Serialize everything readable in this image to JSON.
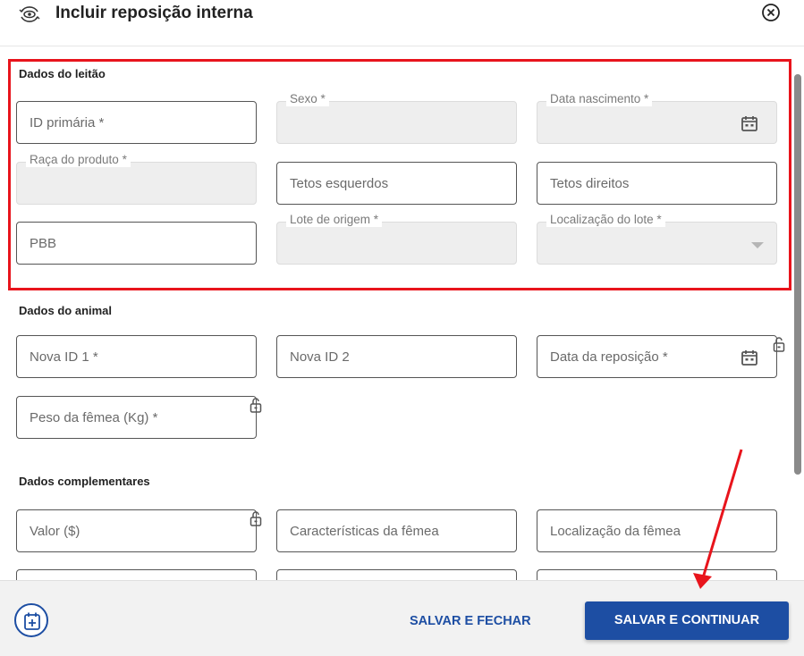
{
  "header": {
    "title": "Incluir reposição interna",
    "icon": "eye-refresh-icon",
    "close_icon": "close-circle-icon"
  },
  "sections": {
    "leitao": {
      "title": "Dados do leitão",
      "fields": {
        "id_primaria": "ID primária *",
        "sexo": "Sexo *",
        "data_nascimento": "Data nascimento *",
        "raca_produto": "Raça do produto *",
        "tetos_esquerdos": "Tetos esquerdos",
        "tetos_direitos": "Tetos direitos",
        "pbb": "PBB",
        "lote_origem": "Lote de origem *",
        "localizacao_lote": "Localização do lote *"
      }
    },
    "animal": {
      "title": "Dados do animal",
      "fields": {
        "nova_id_1": "Nova ID 1 *",
        "nova_id_2": "Nova ID 2",
        "data_reposicao": "Data da reposição *",
        "peso_femea": "Peso da fêmea (Kg) *"
      }
    },
    "complementares": {
      "title": "Dados complementares",
      "fields": {
        "valor": "Valor ($)",
        "caracteristicas_femea": "Características da fêmea",
        "localizacao_femea": "Localização da fêmea"
      }
    }
  },
  "footer": {
    "fab_icon": "calendar-plus-icon",
    "save_close_label": "SALVAR E FECHAR",
    "save_continue_label": "SALVAR E CONTINUAR"
  },
  "colors": {
    "primary": "#1d4ea3",
    "highlight": "#e8141c",
    "disabled_bg": "#eeeeee"
  }
}
